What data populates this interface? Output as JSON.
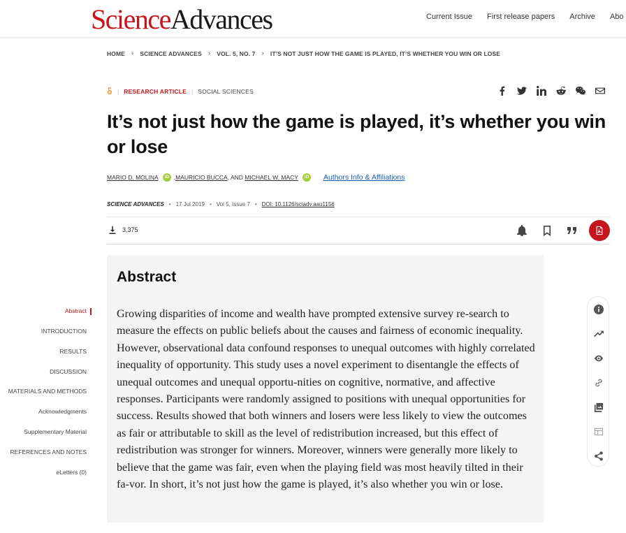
{
  "header": {
    "logo_science": "Science",
    "logo_advances": "Advances",
    "nav": [
      "Current Issue",
      "First release papers",
      "Archive",
      "Abo"
    ]
  },
  "breadcrumb": [
    "HOME",
    "SCIENCE ADVANCES",
    "VOL. 5, NO. 7",
    "IT’S NOT JUST HOW THE GAME IS PLAYED, IT’S WHETHER YOU WIN OR LOSE"
  ],
  "meta": {
    "article_type": "RESEARCH ARTICLE",
    "subject": "SOCIAL SCIENCES"
  },
  "share_icons": [
    "facebook-icon",
    "twitter-icon",
    "linkedin-icon",
    "reddit-icon",
    "wechat-icon",
    "email-icon"
  ],
  "title": "It’s not just how the game is played, it’s whether you win or lose",
  "authors": {
    "a1": "MARIO D. MOLINA",
    "sep1": ",",
    "a2": "MAURICIO BUCCA",
    "sep2": ", AND",
    "a3": "MICHAEL W. MACY",
    "orcid_label": "iD",
    "affiliations": "Authors Info & Affiliations"
  },
  "journal": {
    "name": "SCIENCE ADVANCES",
    "date": "17 Jul 2019",
    "volume": "Vol 5, Issue 7",
    "doi": "DOI: 10.1126/sciadv.aau1156"
  },
  "toolbar": {
    "downloads": "3,375"
  },
  "toc": [
    "Abstract",
    "INTRODUCTION",
    "RESULTS",
    "DISCUSSION",
    "MATERIALS AND METHODS",
    "Acknowledgments",
    "Supplementary Material",
    "REFERENCES AND NOTES",
    "eLetters (0)"
  ],
  "abstract": {
    "heading": "Abstract",
    "body": "Growing disparities of income and wealth have prompted extensive survey re-search to measure the effects on public beliefs about the causes and fairness of economic inequality. However, observational data confound responses to unequal outcomes with highly correlated inequality of opportunity. This study uses a novel experiment to disentangle the effects of unequal outcomes and unequal opportu-nities on cognitive, normative, and affective responses. Participants were randomly assigned to positions with unequal opportunities for success. Results showed that both winners and losers were less likely to view the outcomes as fair or attributable to skill as the level of redistribution increased, but this effect of redistribution was stronger for winners. Moreover, winners were generally more likely to believe that the game was fair, even when the playing field was most heavily tilted in their fa-vor. In short, it’s not just how the game is played, it’s also whether you win or lose."
  },
  "rail_icons": [
    "info-icon",
    "trending-icon",
    "eye-icon",
    "link-icon",
    "image-icon",
    "table-icon",
    "share-icon"
  ]
}
